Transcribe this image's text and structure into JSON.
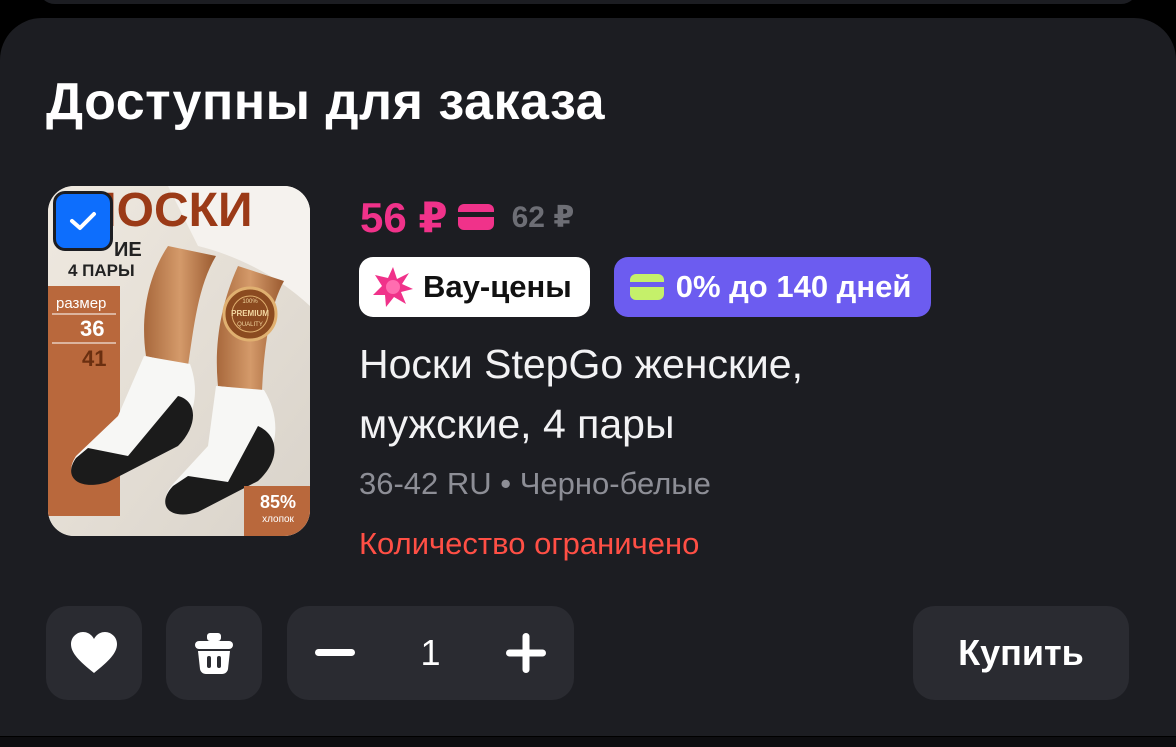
{
  "section": {
    "title": "Доступны для заказа"
  },
  "product": {
    "selected": true,
    "image": {
      "brand_text": "НОСКИ",
      "subtitle_text": "ИЕ",
      "pairs_text": "4 ПАРЫ",
      "size_label": "размер",
      "size_from": "36",
      "size_to": "41",
      "seal_text": "PREMIUM",
      "seal_top": "100%",
      "seal_bottom": "QUALITY",
      "cotton_percent": "85%",
      "cotton_label": "хлопок"
    },
    "price": {
      "current": "56 ₽",
      "old": "62 ₽",
      "accent_color": "#f0328a"
    },
    "badges": {
      "wow": "Вау-цены",
      "installment": "0% до 140 дней"
    },
    "name": "Носки StepGo женские, мужские, 4 пары",
    "variant": "36-42 RU • Черно-белые",
    "stock_note": "Количество ограничено"
  },
  "actions": {
    "favorite_icon": "heart-icon",
    "delete_icon": "trash-icon",
    "quantity": "1",
    "buy_label": "Купить"
  }
}
